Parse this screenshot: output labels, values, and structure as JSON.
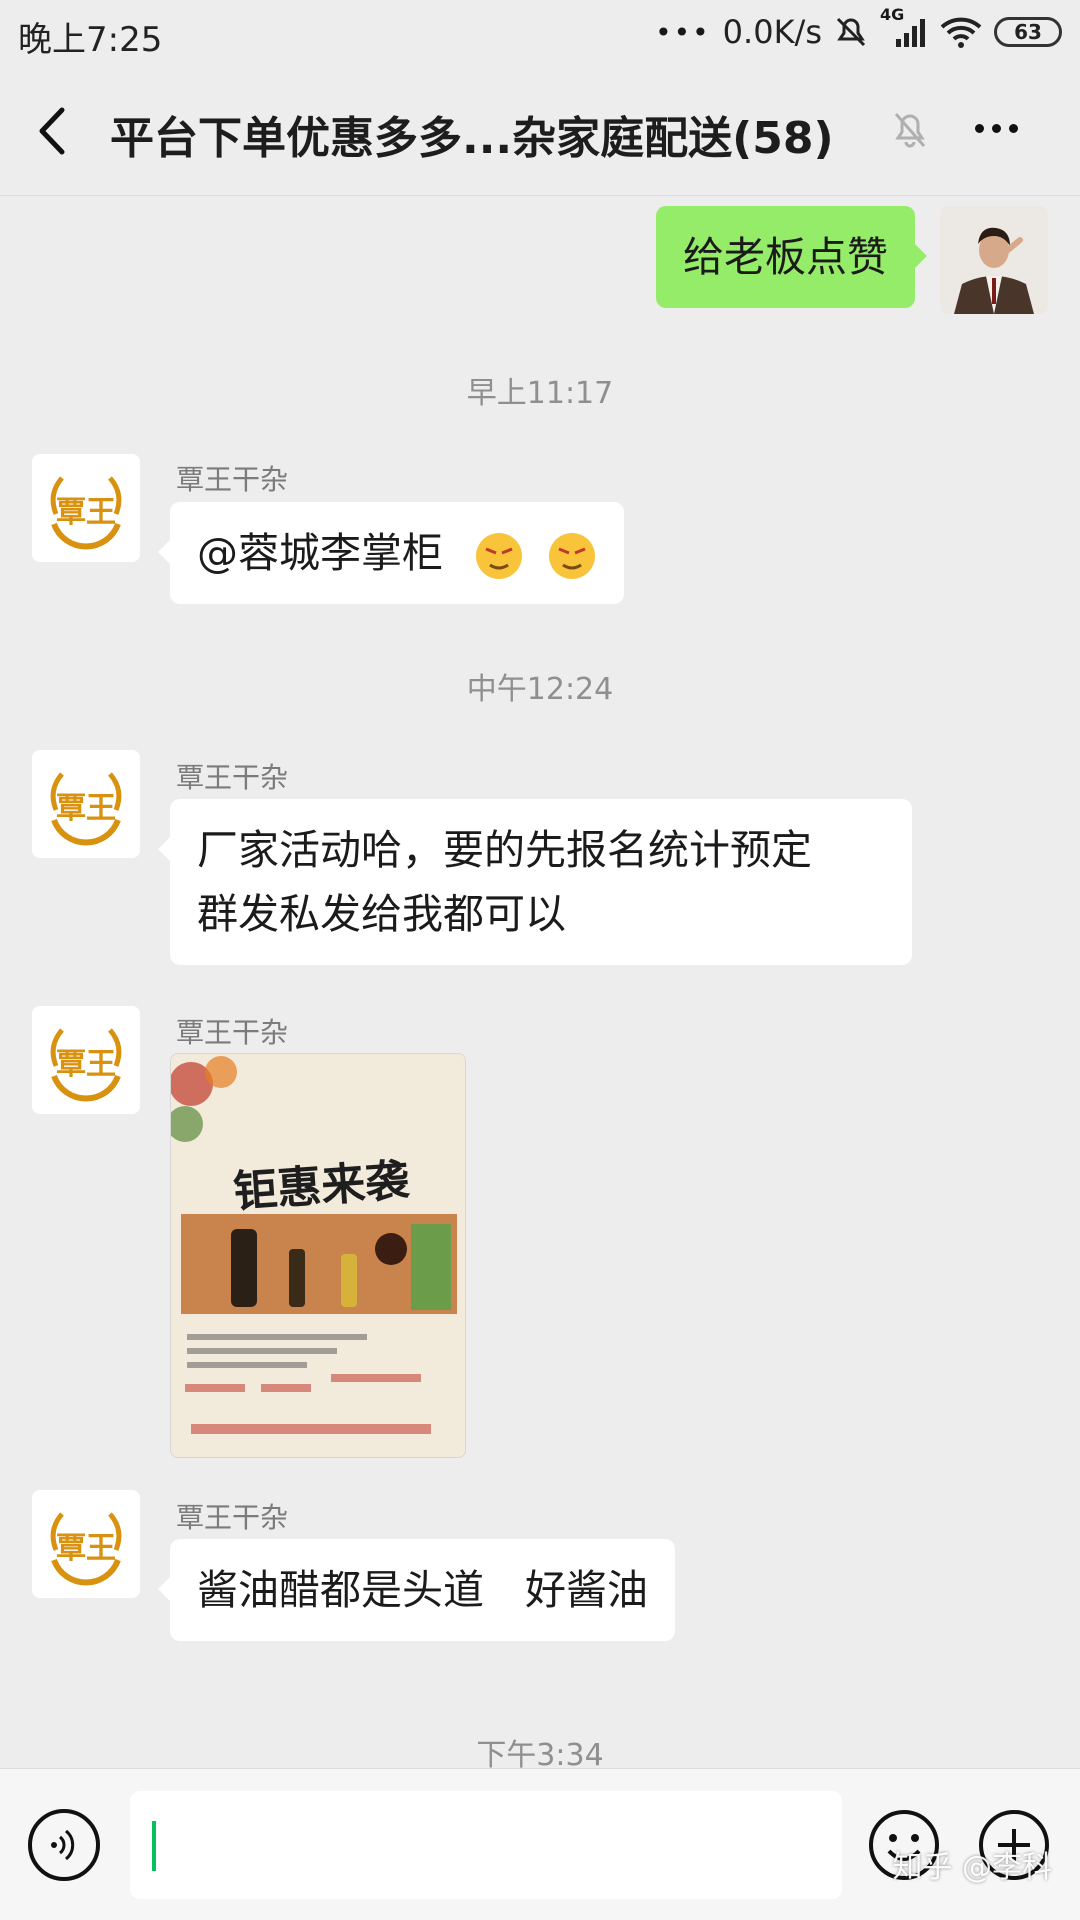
{
  "status_bar": {
    "time": "晚上7:25",
    "net_speed": "0.0K/s",
    "network": "4G",
    "battery": "63"
  },
  "header": {
    "title": "平台下单优惠多多...杂家庭配送(58)"
  },
  "messages": [
    {
      "type": "outgoing",
      "text": "给老板点赞"
    },
    {
      "type": "timestamp",
      "text": "早上11:17"
    },
    {
      "type": "incoming",
      "sender": "覃王干杂",
      "text": "@蓉城李掌柜"
    },
    {
      "type": "timestamp",
      "text": "中午12:24"
    },
    {
      "type": "incoming",
      "sender": "覃王干杂",
      "lines": [
        "厂家活动哈，要的先报名统计预定",
        "群发私发给我都可以"
      ]
    },
    {
      "type": "incoming_image",
      "sender": "覃王干杂",
      "image_text": "钜惠来袭"
    },
    {
      "type": "incoming",
      "sender": "覃王干杂",
      "text": "酱油醋都是头道　好酱油"
    },
    {
      "type": "timestamp",
      "text": "下午3:34"
    }
  ],
  "watermark": "知乎 @李科",
  "colors": {
    "background": "#ededed",
    "outgoing_bubble": "#95ec69",
    "incoming_bubble": "#ffffff",
    "caret": "#07c160",
    "logo_gold": "#d9920f"
  }
}
